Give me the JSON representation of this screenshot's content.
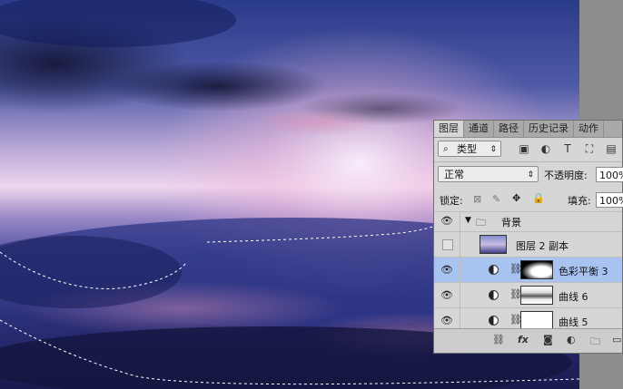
{
  "panel": {
    "tabs": [
      {
        "label": "图层"
      },
      {
        "label": "通道"
      },
      {
        "label": "路径"
      },
      {
        "label": "历史记录"
      },
      {
        "label": "动作"
      }
    ],
    "filter_type": "类型",
    "blend_mode": "正常",
    "opacity_label": "不透明度:",
    "opacity_value": "100%",
    "lock_label": "锁定:",
    "fill_label": "填充:",
    "fill_value": "100%",
    "group_name": "背景",
    "layers": [
      {
        "name": "图层 2 副本"
      },
      {
        "name": "色彩平衡 3"
      },
      {
        "name": "曲线 6"
      },
      {
        "name": "曲线 5"
      }
    ],
    "fx_label": "fx"
  },
  "colors": {
    "panel_bg": "#d6d6d6",
    "selected_row": "#a8c3f0",
    "sky_top": "#2b3a87",
    "sky_glow": "#f3d6ef"
  }
}
